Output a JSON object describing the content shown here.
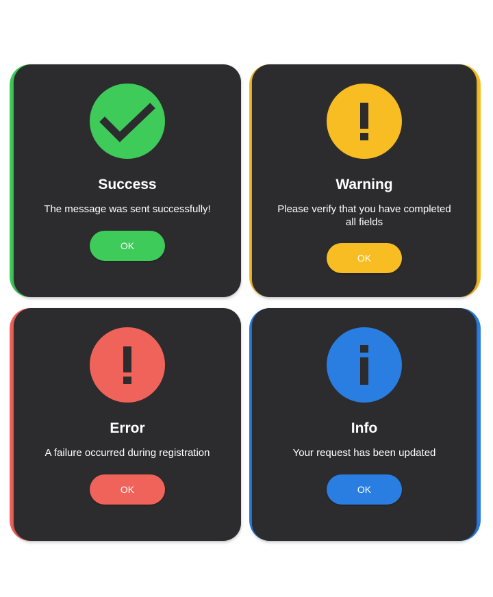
{
  "dialogs": {
    "success": {
      "title": "Success",
      "message": "The message was sent successfully!",
      "button_label": "OK",
      "accent_color": "#3ecb5a",
      "icon": "check-icon"
    },
    "warning": {
      "title": "Warning",
      "message": "Please verify that you have completed all fields",
      "button_label": "OK",
      "accent_color": "#f7bd23",
      "icon": "exclamation-icon"
    },
    "error": {
      "title": "Error",
      "message": "A failure occurred during registration",
      "button_label": "OK",
      "accent_color": "#f0635a",
      "icon": "exclamation-icon"
    },
    "info": {
      "title": "Info",
      "message": "Your request has been updated",
      "button_label": "OK",
      "accent_color": "#2a7de1",
      "icon": "info-icon"
    }
  },
  "card_background": "#2c2c2e"
}
